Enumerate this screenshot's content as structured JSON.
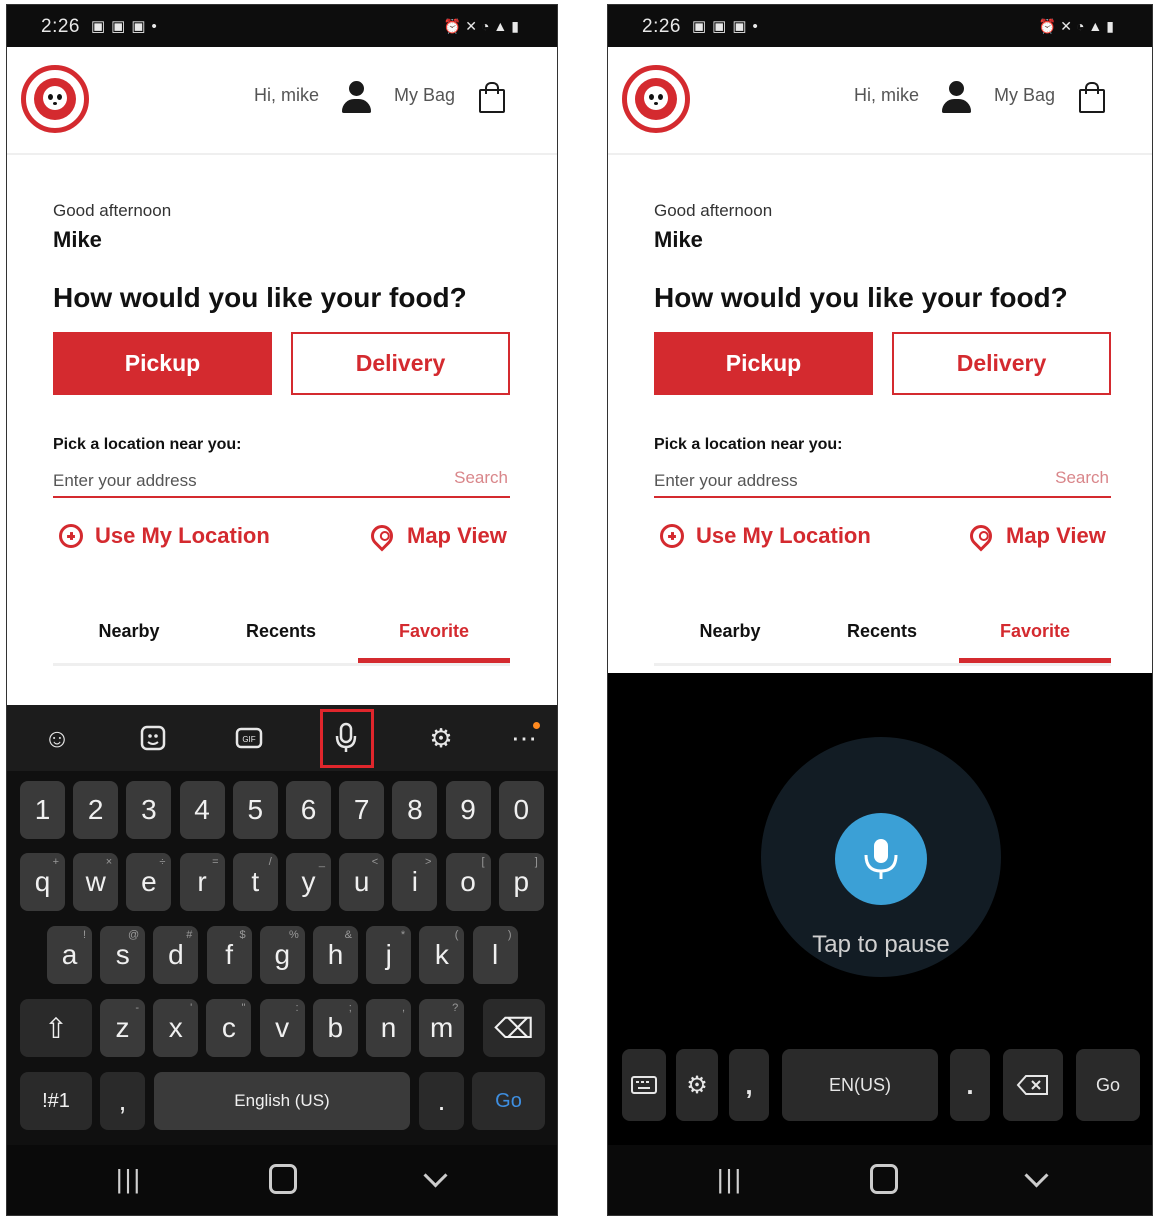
{
  "phones": [
    {
      "status": {
        "time": "2:26"
      },
      "header": {
        "greeting": "Hi, mike",
        "bag_label": "My Bag"
      },
      "greeting": {
        "line": "Good afternoon",
        "name": "Mike"
      },
      "question": "How would you like your food?",
      "buttons": {
        "pickup": "Pickup",
        "delivery": "Delivery"
      },
      "location": {
        "label": "Pick a location near you:",
        "placeholder": "Enter your address",
        "search": "Search",
        "use_my_location": "Use My Location",
        "map_view": "Map View"
      },
      "tabs": [
        "Nearby",
        "Recents",
        "Favorite"
      ],
      "keyboard": {
        "row_numbers": [
          "1",
          "2",
          "3",
          "4",
          "5",
          "6",
          "7",
          "8",
          "9",
          "0"
        ],
        "row_top": [
          "q",
          "w",
          "e",
          "r",
          "t",
          "y",
          "u",
          "i",
          "o",
          "p"
        ],
        "row_top_sub": [
          "+",
          "×",
          "÷",
          "=",
          "/",
          "_",
          "<",
          ">",
          "[",
          "]"
        ],
        "row_mid": [
          "a",
          "s",
          "d",
          "f",
          "g",
          "h",
          "j",
          "k",
          "l"
        ],
        "row_mid_sub": [
          "!",
          "@",
          "#",
          "$",
          "%",
          "&",
          "*",
          "(",
          ")"
        ],
        "row_bottom": [
          "z",
          "x",
          "c",
          "v",
          "b",
          "n",
          "m"
        ],
        "row_bottom_sub": [
          "-",
          "'",
          "\"",
          ":",
          ";",
          ",",
          "?"
        ],
        "symbols": "!#1",
        "comma": ",",
        "space": "English (US)",
        "period": ".",
        "go": "Go"
      }
    },
    {
      "status": {
        "time": "2:26"
      },
      "header": {
        "greeting": "Hi, mike",
        "bag_label": "My Bag"
      },
      "greeting": {
        "line": "Good afternoon",
        "name": "Mike"
      },
      "question": "How would you like your food?",
      "buttons": {
        "pickup": "Pickup",
        "delivery": "Delivery"
      },
      "location": {
        "label": "Pick a location near you:",
        "placeholder": "Enter your address",
        "search": "Search",
        "use_my_location": "Use My Location",
        "map_view": "Map View"
      },
      "tabs": [
        "Nearby",
        "Recents",
        "Favorite"
      ],
      "voice": {
        "status": "Tap to pause",
        "comma": ",",
        "language": "EN(US)",
        "period": ".",
        "go": "Go"
      }
    }
  ],
  "colors": {
    "brand_red": "#d42a2f",
    "voice_blue": "#3ba0d6"
  }
}
